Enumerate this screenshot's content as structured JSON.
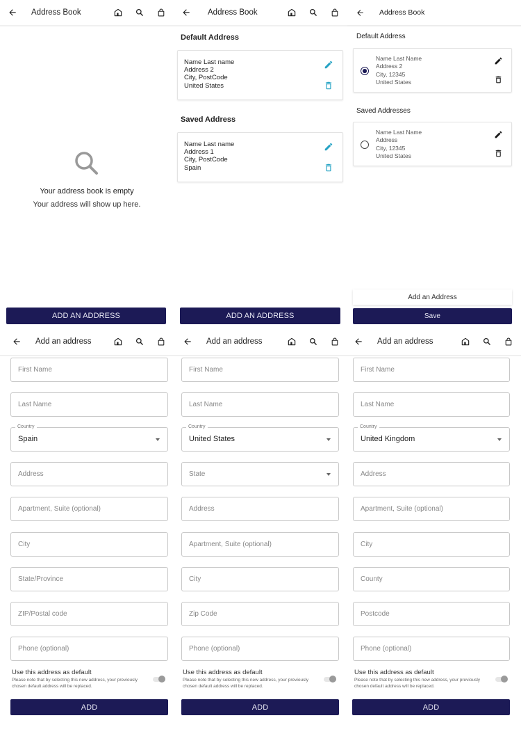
{
  "colors": {
    "primary": "#1c1a56",
    "accent_icon": "#26a3c4",
    "border": "#c8c8c8"
  },
  "header_icons": [
    "store-icon",
    "search-icon",
    "shopping-bag-icon"
  ],
  "screens": {
    "empty_book": {
      "title": "Address Book",
      "empty_title": "Your address book is empty",
      "empty_subtitle": "Your address will show up here.",
      "add_button": "ADD AN ADDRESS"
    },
    "book_v1": {
      "title": "Address Book",
      "default_heading": "Default Address",
      "default_address": {
        "line1": "Name Last name",
        "line2": "Address 2",
        "line3": "City, PostCode",
        "line4": "United States"
      },
      "saved_heading": "Saved Address",
      "saved_address": {
        "line1": "Name Last name",
        "line2": "Address 1",
        "line3": "City, PostCode",
        "line4": "Spain"
      },
      "add_button": "ADD AN ADDRESS"
    },
    "book_v2": {
      "title": "Address Book",
      "default_heading": "Default Address",
      "default_address": {
        "line1": "Name Last Name",
        "line2": "Address 2",
        "line3": "City, 12345",
        "line4": "United States",
        "selected": true
      },
      "saved_heading": "Saved Addresses",
      "saved_address": {
        "line1": "Name Last Name",
        "line2": "Address",
        "line3": "City, 12345",
        "line4": "United States",
        "selected": false
      },
      "add_button": "Add an Address",
      "save_button": "Save"
    },
    "form_spain": {
      "title": "Add an address",
      "first_name": "First Name",
      "last_name": "Last Name",
      "country_label": "Country",
      "country_value": "Spain",
      "address": "Address",
      "apartment": "Apartment, Suite (optional)",
      "city": "City",
      "region": "State/Province",
      "postal": "ZIP/Postal code",
      "phone": "Phone (optional)",
      "default_heading": "Use this address as default",
      "default_note": "Please note that by selecting this new address, your previously chosen default address will be replaced.",
      "default_on": false,
      "add_button": "ADD"
    },
    "form_us": {
      "title": "Add an address",
      "first_name": "First Name",
      "last_name": "Last Name",
      "country_label": "Country",
      "country_value": "United States",
      "state": "State",
      "address": "Address",
      "apartment": "Apartment, Suite (optional)",
      "city": "City",
      "postal": "Zip Code",
      "phone": "Phone (optional)",
      "default_heading": "Use this address as default",
      "default_note": "Please note that by selecting this new address, your previously chosen default address will be replaced.",
      "default_on": false,
      "add_button": "ADD"
    },
    "form_uk": {
      "title": "Add an address",
      "first_name": "First Name",
      "last_name": "Last Name",
      "country_label": "Country",
      "country_value": "United Kingdom",
      "address": "Address",
      "apartment": "Apartment, Suite (optional)",
      "city": "City",
      "region": "County",
      "postal": "Postcode",
      "phone": "Phone (optional)",
      "default_heading": "Use this address as default",
      "default_note": "Please note that by selecting this new address, your previously chosen default address will be replaced.",
      "default_on": false,
      "add_button": "ADD"
    }
  }
}
